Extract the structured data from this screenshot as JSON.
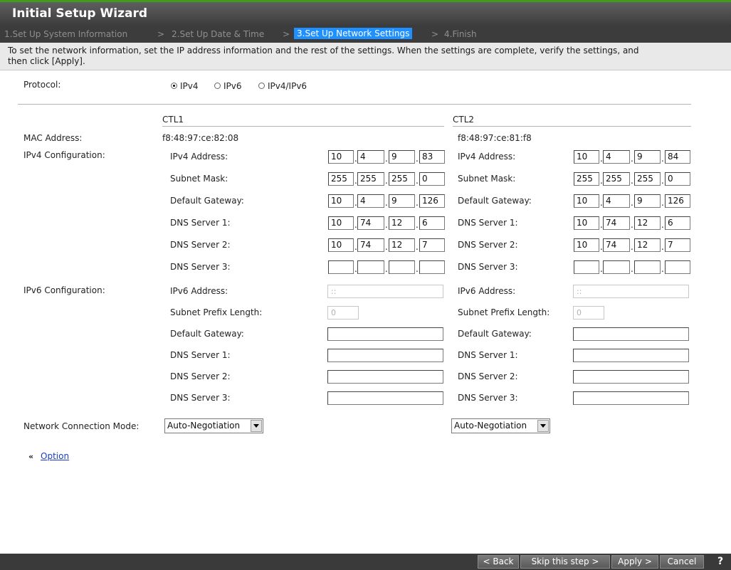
{
  "title": "Initial Setup Wizard",
  "steps": {
    "s1": "1.Set Up System Information",
    "s2": "2.Set Up Date & Time",
    "s3": "3.Set Up Network Settings",
    "s4": "4.Finish",
    "sep": ">"
  },
  "description": {
    "line1": "To set the network information, set the IP address information and the rest of the settings. When the settings are complete, verify the settings, and",
    "line2": "then click [Apply]."
  },
  "protocol": {
    "label": "Protocol:",
    "options": [
      "IPv4",
      "IPv6",
      "IPv4/IPv6"
    ],
    "selected": "IPv4"
  },
  "controllers": [
    "CTL1",
    "CTL2"
  ],
  "mac": {
    "label": "MAC Address:",
    "ctl1": "f8:48:97:ce:82:08",
    "ctl2": "f8:48:97:ce:81:f8"
  },
  "ipv4": {
    "section_label": "IPv4 Configuration:",
    "labels": [
      "IPv4 Address:",
      "Subnet Mask:",
      "Default Gateway:",
      "DNS Server 1:",
      "DNS Server 2:",
      "DNS Server 3:"
    ],
    "ctl1": [
      [
        "10",
        "4",
        "9",
        "83"
      ],
      [
        "255",
        "255",
        "255",
        "0"
      ],
      [
        "10",
        "4",
        "9",
        "126"
      ],
      [
        "10",
        "74",
        "12",
        "6"
      ],
      [
        "10",
        "74",
        "12",
        "7"
      ],
      [
        "",
        "",
        "",
        ""
      ]
    ],
    "ctl2": [
      [
        "10",
        "4",
        "9",
        "84"
      ],
      [
        "255",
        "255",
        "255",
        "0"
      ],
      [
        "10",
        "4",
        "9",
        "126"
      ],
      [
        "10",
        "74",
        "12",
        "6"
      ],
      [
        "10",
        "74",
        "12",
        "7"
      ],
      [
        "",
        "",
        "",
        ""
      ]
    ],
    "dot": "."
  },
  "ipv6": {
    "section_label": "IPv6 Configuration:",
    "labels": [
      "IPv6 Address:",
      "Subnet Prefix Length:",
      "Default Gateway:",
      "DNS Server 1:",
      "DNS Server 2:",
      "DNS Server 3:"
    ],
    "address_placeholder": "::",
    "prefix_placeholder": "0"
  },
  "network_mode": {
    "label": "Network Connection Mode:",
    "ctl1": "Auto-Negotiation",
    "ctl2": "Auto-Negotiation"
  },
  "option": {
    "chevron": "«",
    "label": "Option"
  },
  "footer": {
    "back": "< Back",
    "skip": "Skip this step >",
    "apply": "Apply >",
    "cancel": "Cancel",
    "help": "?"
  }
}
